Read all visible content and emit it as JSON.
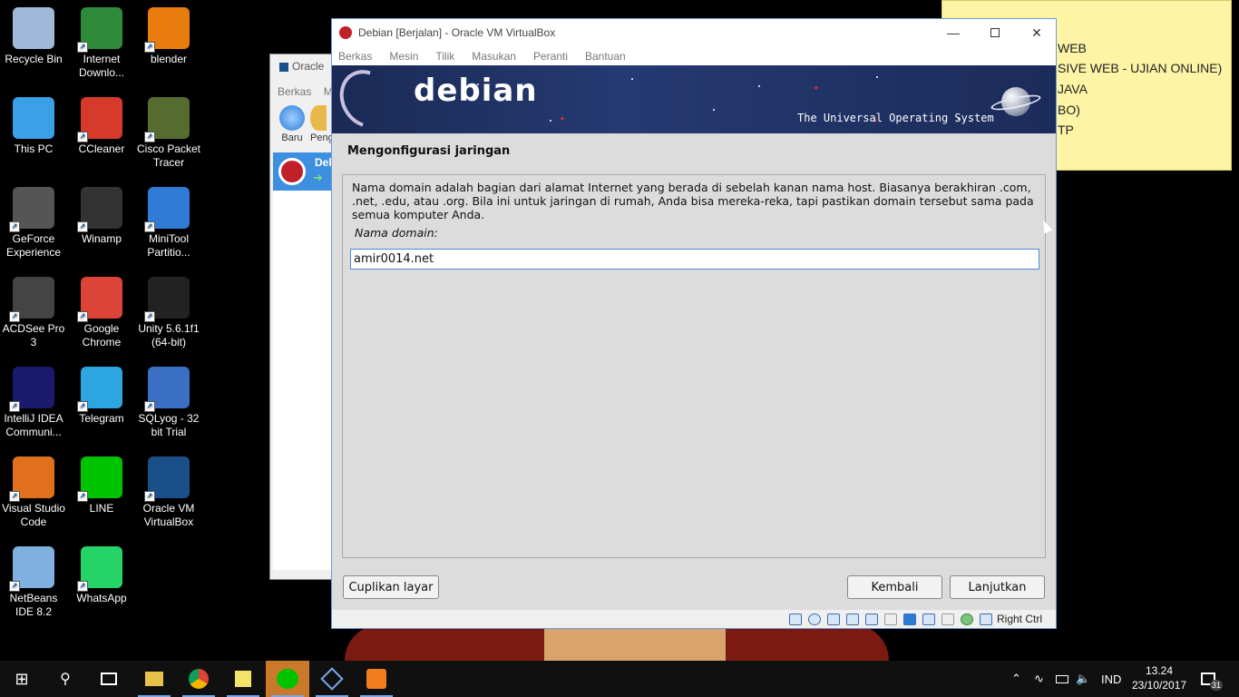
{
  "desktop": {
    "icons": [
      {
        "label": "Recycle Bin",
        "icon": "recycle-bin-icon",
        "color": "#9fb8d8"
      },
      {
        "label": "Internet Downlo...",
        "icon": "download-manager-icon",
        "color": "#2e8b3a"
      },
      {
        "label": "blender",
        "icon": "blender-icon",
        "color": "#e87d0d"
      },
      {
        "label": "This PC",
        "icon": "computer-icon",
        "color": "#3aa0e8"
      },
      {
        "label": "CCleaner",
        "icon": "ccleaner-icon",
        "color": "#d63a2a"
      },
      {
        "label": "Cisco Packet Tracer",
        "icon": "packet-tracer-icon",
        "color": "#556b2f"
      },
      {
        "label": "GeForce Experience",
        "icon": "geforce-icon",
        "color": "#555555"
      },
      {
        "label": "Winamp",
        "icon": "winamp-icon",
        "color": "#333333"
      },
      {
        "label": "MiniTool Partitio...",
        "icon": "minitool-icon",
        "color": "#2f7bd6"
      },
      {
        "label": "ACDSee Pro 3",
        "icon": "acdsee-icon",
        "color": "#444444"
      },
      {
        "label": "Google Chrome",
        "icon": "chrome-icon",
        "color": "#db4437"
      },
      {
        "label": "Unity 5.6.1f1 (64-bit)",
        "icon": "unity-icon",
        "color": "#222222"
      },
      {
        "label": "IntelliJ IDEA Communi...",
        "icon": "intellij-icon",
        "color": "#1a1a6e"
      },
      {
        "label": "Telegram",
        "icon": "telegram-icon",
        "color": "#2ca5e0"
      },
      {
        "label": "SQLyog - 32 bit Trial",
        "icon": "sqlyog-icon",
        "color": "#3a6fc4"
      },
      {
        "label": "Visual Studio Code",
        "icon": "vscode-icon",
        "color": "#e0701e"
      },
      {
        "label": "LINE",
        "icon": "line-icon",
        "color": "#00c300"
      },
      {
        "label": "Oracle VM VirtualBox",
        "icon": "virtualbox-icon",
        "color": "#1b4f8a"
      },
      {
        "label": "NetBeans IDE 8.2",
        "icon": "netbeans-icon",
        "color": "#7fb0e0"
      },
      {
        "label": "WhatsApp",
        "icon": "whatsapp-icon",
        "color": "#25d366"
      }
    ]
  },
  "sticky_note": {
    "lines": [
      "WEB",
      "SIVE WEB - UJIAN ONLINE)",
      "JAVA",
      "BO)",
      "TP"
    ]
  },
  "vbox_manager": {
    "title": "Oracle",
    "menu": [
      "Berkas",
      "M"
    ],
    "toolbar": [
      "Baru",
      "Peng"
    ],
    "selected_vm": "Deb"
  },
  "vm_window": {
    "title": "Debian [Berjalan] - Oracle VM VirtualBox",
    "menu": [
      "Berkas",
      "Mesin",
      "Tilik",
      "Masukan",
      "Peranti",
      "Bantuan"
    ],
    "banner": {
      "logo": "debian",
      "tagline": "The Universal Operating System"
    },
    "installer": {
      "section_title": "Mengonfigurasi jaringan",
      "description": "Nama domain adalah bagian dari alamat Internet yang berada di sebelah kanan nama host. Biasanya berakhiran .com, .net, .edu, atau .org. Bila ini untuk jaringan di rumah, Anda bisa mereka-reka, tapi pastikan domain tersebut sama pada semua komputer Anda.",
      "field_label": "Nama domain:",
      "field_value": "amir0014.net",
      "screenshot_button": "Cuplikan layar",
      "back_button": "Kembali",
      "continue_button": "Lanjutkan"
    },
    "host_key": "Right Ctrl"
  },
  "taskbar": {
    "language": "IND",
    "time": "13.24",
    "date": "23/10/2017",
    "notification_count": "31",
    "accent": "#7aa7e8"
  }
}
